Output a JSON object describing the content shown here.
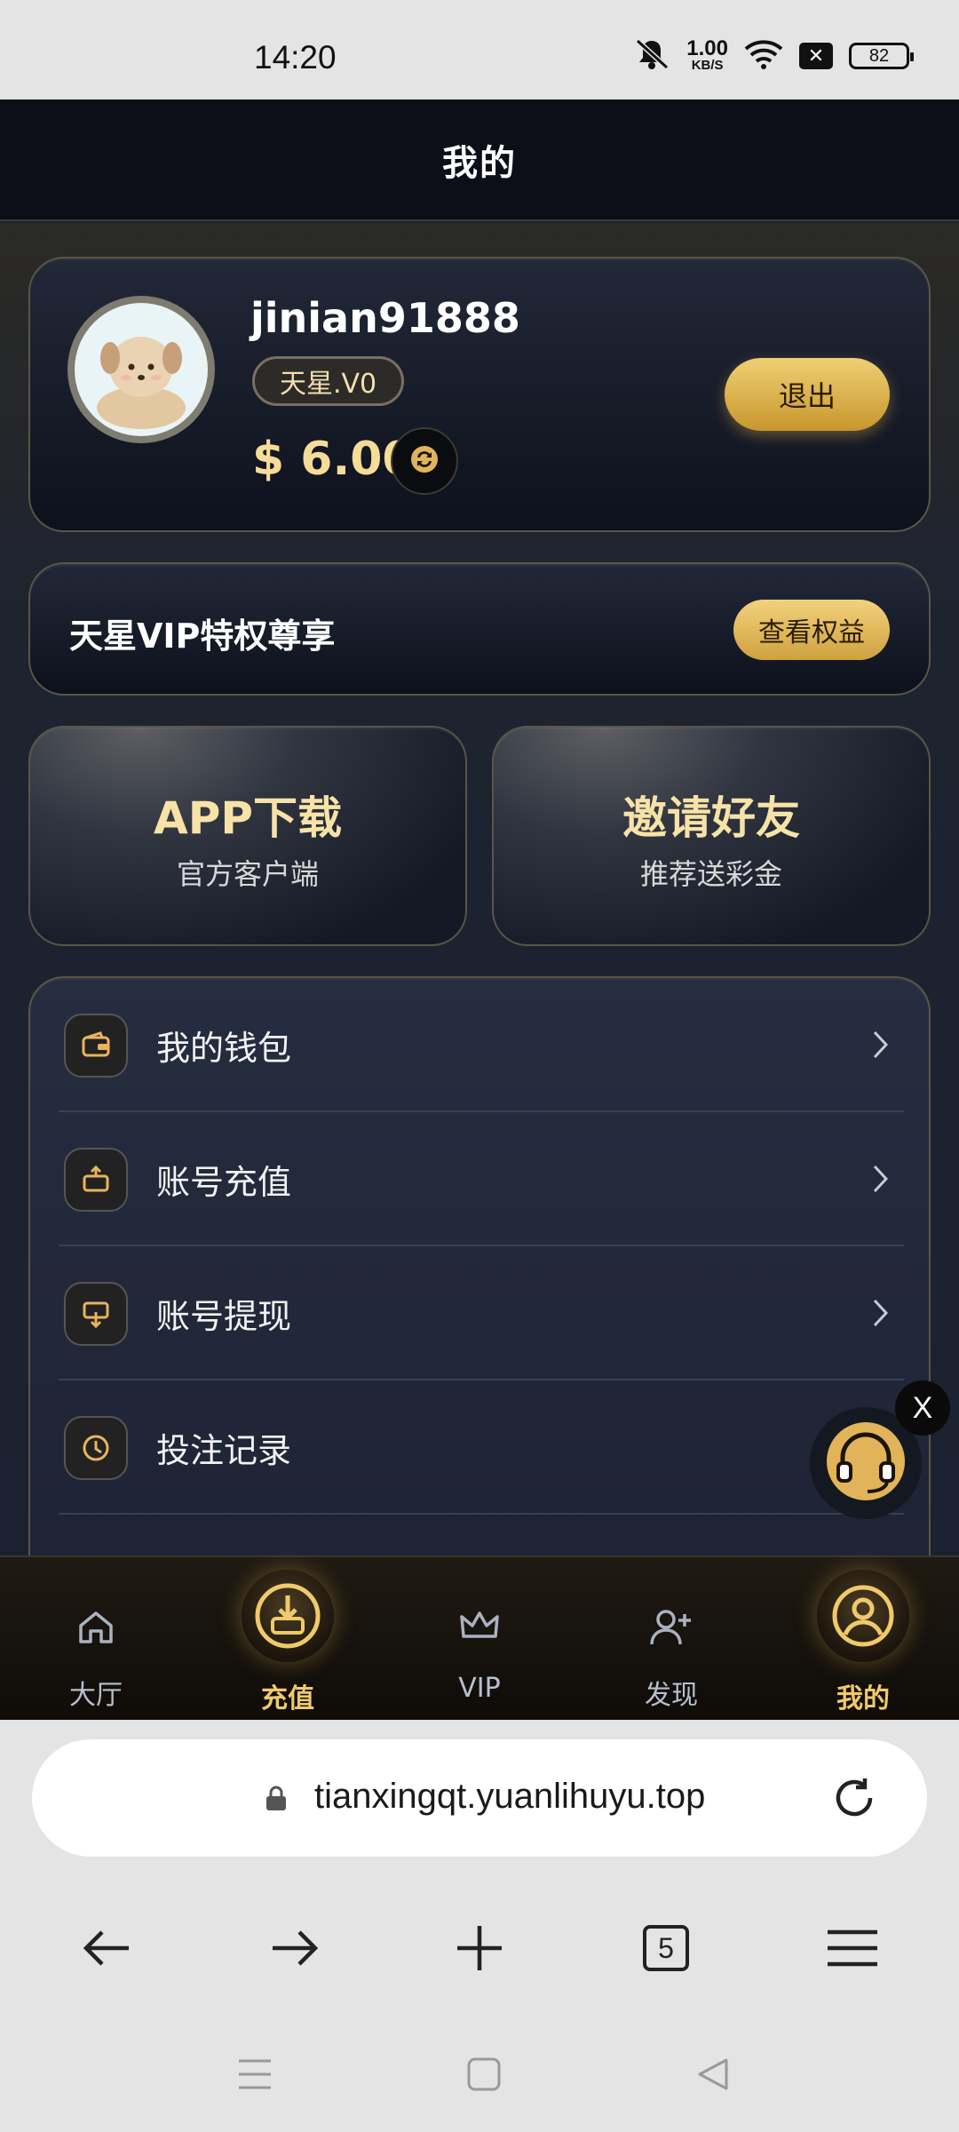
{
  "status_bar": {
    "time": "14:20",
    "net_speed_value": "1.00",
    "net_speed_unit": "KB/S",
    "battery": "82",
    "icons": [
      "mute-icon",
      "wifi-icon",
      "x-badge-icon",
      "battery-icon"
    ]
  },
  "header": {
    "title": "我的"
  },
  "profile": {
    "username": "jinian91888",
    "vip_level": "天星.V0",
    "balance": "$ 6.00",
    "logout_label": "退出"
  },
  "vip_banner": {
    "text": "天星VIP特权尊享",
    "button_label": "查看权益"
  },
  "tiles": [
    {
      "title": "APP下载",
      "subtitle": "官方客户端"
    },
    {
      "title": "邀请好友",
      "subtitle": "推荐送彩金"
    }
  ],
  "menu": {
    "items": [
      {
        "label": "我的钱包",
        "icon": "wallet-icon"
      },
      {
        "label": "账号充值",
        "icon": "recharge-icon"
      },
      {
        "label": "账号提现",
        "icon": "withdraw-icon"
      },
      {
        "label": "投注记录",
        "icon": "clock-icon"
      }
    ]
  },
  "support": {
    "close_label": "X"
  },
  "tabbar": {
    "items": [
      {
        "label": "大厅",
        "icon": "home-icon"
      },
      {
        "label": "充值",
        "icon": "deposit-icon"
      },
      {
        "label": "VIP",
        "icon": "crown-icon"
      },
      {
        "label": "发现",
        "icon": "add-user-icon"
      },
      {
        "label": "我的",
        "icon": "user-icon"
      }
    ],
    "active": "我的",
    "accent_color": "#f0c96a"
  },
  "browser": {
    "url": "tianxingqt.yuanlihuyu.top",
    "tab_count": "5"
  }
}
